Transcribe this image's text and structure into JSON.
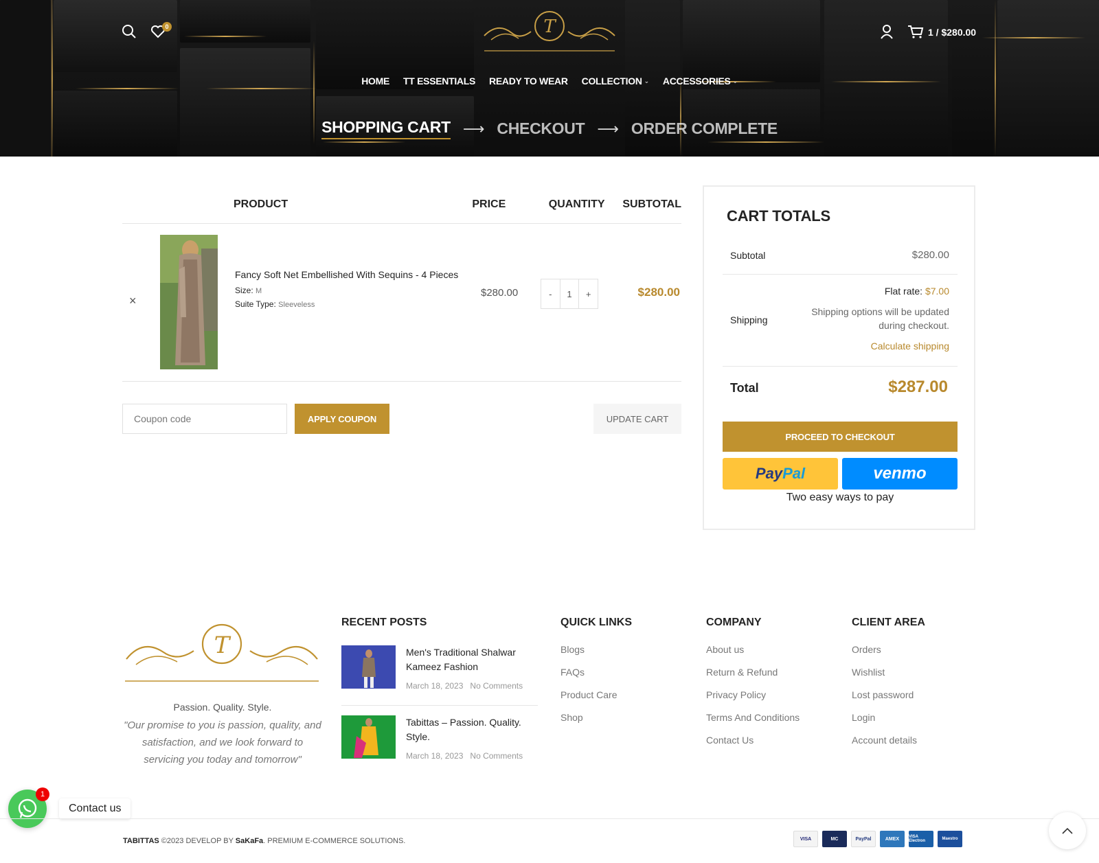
{
  "header": {
    "wishlist_count": "0",
    "cart_summary": "1 / $280.00",
    "logo_text": "Tabitta's"
  },
  "nav": [
    {
      "label": "HOME",
      "dropdown": false
    },
    {
      "label": "TT ESSENTIALS",
      "dropdown": false
    },
    {
      "label": "READY TO WEAR",
      "dropdown": false
    },
    {
      "label": "COLLECTION",
      "dropdown": true
    },
    {
      "label": "ACCESSORIES",
      "dropdown": true
    }
  ],
  "steps": [
    "SHOPPING CART",
    "CHECKOUT",
    "ORDER COMPLETE"
  ],
  "cart": {
    "headers": {
      "product": "PRODUCT",
      "price": "PRICE",
      "quantity": "QUANTITY",
      "subtotal": "SUBTOTAL"
    },
    "items": [
      {
        "name": "Fancy Soft Net Embellished With Sequins - 4 Pieces",
        "size_label": "Size:",
        "size": "M",
        "suite_label": "Suite Type:",
        "suite": "Sleeveless",
        "price": "$280.00",
        "quantity": "1",
        "subtotal": "$280.00"
      }
    ],
    "coupon_placeholder": "Coupon code",
    "apply_coupon": "APPLY COUPON",
    "update_cart": "UPDATE CART"
  },
  "totals": {
    "title": "CART TOTALS",
    "subtotal_label": "Subtotal",
    "subtotal": "$280.00",
    "shipping_label": "Shipping",
    "flat_rate_label": "Flat rate:",
    "flat_rate": "$7.00",
    "shipping_note_1": "Shipping options will be updated",
    "shipping_note_2": "during checkout.",
    "calc_shipping": "Calculate shipping",
    "total_label": "Total",
    "total": "$287.00",
    "checkout_button": "PROCEED TO CHECKOUT",
    "paypal_pay": "Pay",
    "paypal_pal": "Pal",
    "venmo": "venmo",
    "two_ways": "Two easy ways to pay"
  },
  "footer": {
    "tagline": "Passion. Quality. Style.",
    "quote": "\"Our promise to you is passion, quality, and satisfaction, and we look forward to servicing you today and tomorrow\"",
    "recent_posts_title": "RECENT POSTS",
    "posts": [
      {
        "title": "Men's Traditional Shalwar Kameez Fashion",
        "date": "March 18, 2023",
        "comments": "No Comments"
      },
      {
        "title": "Tabittas – Passion. Quality. Style.",
        "date": "March 18, 2023",
        "comments": "No Comments"
      }
    ],
    "quick_links_title": "QUICK LINKS",
    "quick_links": [
      "Blogs",
      "FAQs",
      "Product Care",
      "Shop"
    ],
    "company_title": "COMPANY",
    "company_links": [
      "About us",
      "Return & Refund",
      "Privacy Policy",
      "Terms And Conditions",
      "Contact Us"
    ],
    "client_title": "CLIENT AREA",
    "client_links": [
      "Orders",
      "Wishlist",
      "Lost password",
      "Login",
      "Account details"
    ],
    "copyright_brand": "TABITTAS",
    "copyright_mid": " ©2023 DEVELOP BY ",
    "copyright_dev": "SaKaFa",
    "copyright_tail": ". PREMIUM E-COMMERCE SOLUTIONS.",
    "cards": [
      "VISA",
      "MC",
      "PayPal",
      "AMEX",
      "VISA Electron",
      "Maestro"
    ]
  },
  "whatsapp": {
    "badge": "1",
    "label": "Contact us"
  },
  "colors": {
    "accent": "#c0922f",
    "price": "#b8892d",
    "paypal": "#ffc439",
    "venmo": "#008cff",
    "whatsapp": "#49c95a"
  }
}
